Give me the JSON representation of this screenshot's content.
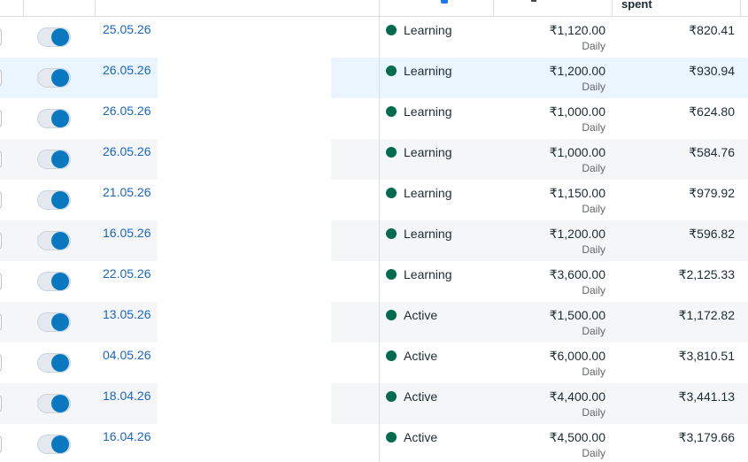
{
  "header": {
    "amount_spent_label": "spent"
  },
  "rows": [
    {
      "date": "25.05.26",
      "status": "Learning",
      "budget": "₹1,120.00",
      "period": "Daily",
      "spent": "₹820.41"
    },
    {
      "date": "26.05.26",
      "status": "Learning",
      "budget": "₹1,200.00",
      "period": "Daily",
      "spent": "₹930.94"
    },
    {
      "date": "26.05.26",
      "status": "Learning",
      "budget": "₹1,000.00",
      "period": "Daily",
      "spent": "₹624.80"
    },
    {
      "date": "26.05.26",
      "status": "Learning",
      "budget": "₹1,000.00",
      "period": "Daily",
      "spent": "₹584.76"
    },
    {
      "date": "21.05.26",
      "status": "Learning",
      "budget": "₹1,150.00",
      "period": "Daily",
      "spent": "₹979.92"
    },
    {
      "date": "16.05.26",
      "status": "Learning",
      "budget": "₹1,200.00",
      "period": "Daily",
      "spent": "₹596.82"
    },
    {
      "date": "22.05.26",
      "status": "Learning",
      "budget": "₹3,600.00",
      "period": "Daily",
      "spent": "₹2,125.33"
    },
    {
      "date": "13.05.26",
      "status": "Active",
      "budget": "₹1,500.00",
      "period": "Daily",
      "spent": "₹1,172.82"
    },
    {
      "date": "04.05.26",
      "status": "Active",
      "budget": "₹6,000.00",
      "period": "Daily",
      "spent": "₹3,810.51"
    },
    {
      "date": "18.04.26",
      "status": "Active",
      "budget": "₹4,400.00",
      "period": "Daily",
      "spent": "₹3,441.13"
    },
    {
      "date": "16.04.26",
      "status": "Active",
      "budget": "₹4,500.00",
      "period": "Daily",
      "spent": "₹3,179.66"
    }
  ],
  "colors": {
    "status_dot": "#006b4e",
    "toggle_on": "#0a78be",
    "link": "#1a66c2",
    "row_highlight": "#ebf5ff",
    "row_alt": "#f5f6f7"
  },
  "icons": {
    "status": "status-dot-icon",
    "toggle": "toggle-switch"
  }
}
